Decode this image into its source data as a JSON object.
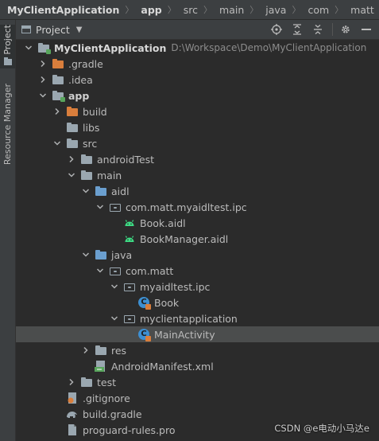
{
  "breadcrumb": [
    "MyClientApplication",
    "app",
    "src",
    "main",
    "java",
    "com",
    "matt",
    "myclientapplica"
  ],
  "stripe": {
    "project_tab": "Project",
    "resource_tab": "Resource Manager"
  },
  "toolbar": {
    "title": "Project"
  },
  "tree": [
    {
      "label": "MyClientApplication",
      "path": "D:\\Workspace\\Demo\\MyClientApplication",
      "icon": "module-folder-icon",
      "arrow": "down",
      "depth": 0,
      "weight": "bold"
    },
    {
      "label": ".gradle",
      "icon": "folder-orange-icon",
      "arrow": "right",
      "depth": 1
    },
    {
      "label": ".idea",
      "icon": "folder-gray-icon",
      "arrow": "right",
      "depth": 1
    },
    {
      "label": "app",
      "icon": "module-folder-icon",
      "arrow": "down",
      "depth": 1,
      "weight": "strong"
    },
    {
      "label": "build",
      "icon": "folder-orange-icon",
      "arrow": "right",
      "depth": 2
    },
    {
      "label": "libs",
      "icon": "folder-gray-icon",
      "arrow": "none",
      "depth": 2
    },
    {
      "label": "src",
      "icon": "folder-gray-icon",
      "arrow": "down",
      "depth": 2
    },
    {
      "label": "androidTest",
      "icon": "folder-gray-icon",
      "arrow": "right",
      "depth": 3
    },
    {
      "label": "main",
      "icon": "folder-gray-icon",
      "arrow": "down",
      "depth": 3
    },
    {
      "label": "aidl",
      "icon": "folder-blue-icon",
      "arrow": "down",
      "depth": 4
    },
    {
      "label": "com.matt.myaidltest.ipc",
      "icon": "package-icon",
      "arrow": "down",
      "depth": 5
    },
    {
      "label": "Book.aidl",
      "icon": "android-icon",
      "arrow": "none",
      "depth": 6
    },
    {
      "label": "BookManager.aidl",
      "icon": "android-icon",
      "arrow": "none",
      "depth": 6
    },
    {
      "label": "java",
      "icon": "folder-blue-icon",
      "arrow": "down",
      "depth": 4
    },
    {
      "label": "com.matt",
      "icon": "package-icon",
      "arrow": "down",
      "depth": 5
    },
    {
      "label": "myaidltest.ipc",
      "icon": "package-icon",
      "arrow": "down",
      "depth": 6
    },
    {
      "label": "Book",
      "icon": "class-icon",
      "arrow": "none",
      "depth": 7
    },
    {
      "label": "myclientapplication",
      "icon": "package-icon",
      "arrow": "down",
      "depth": 6
    },
    {
      "label": "MainActivity",
      "icon": "class-icon",
      "arrow": "none",
      "depth": 7,
      "selected": true
    },
    {
      "label": "res",
      "icon": "res-folder-icon",
      "arrow": "right",
      "depth": 4
    },
    {
      "label": "AndroidManifest.xml",
      "icon": "manifest-icon",
      "arrow": "none",
      "depth": 4
    },
    {
      "label": "test",
      "icon": "folder-gray-icon",
      "arrow": "right",
      "depth": 3
    },
    {
      "label": ".gitignore",
      "icon": "gitignore-icon",
      "arrow": "none",
      "depth": 2
    },
    {
      "label": "build.gradle",
      "icon": "gradle-icon",
      "arrow": "none",
      "depth": 2
    },
    {
      "label": "proguard-rules.pro",
      "icon": "file-icon",
      "arrow": "none",
      "depth": 2
    }
  ],
  "watermark": "CSDN @e电动小马达e"
}
